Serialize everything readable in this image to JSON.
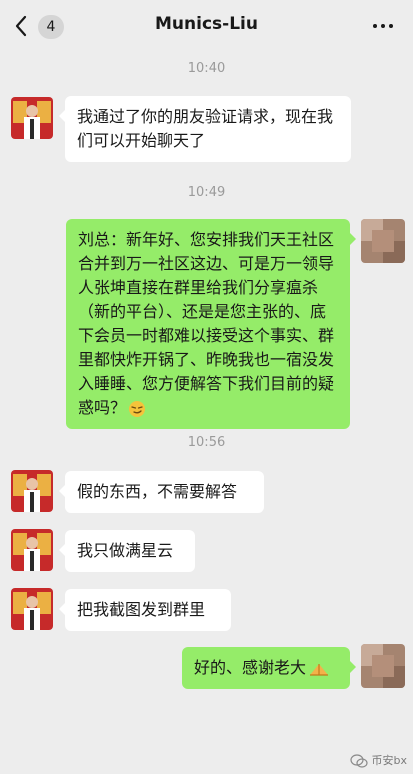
{
  "header": {
    "unread_count": "4",
    "contact_name": "Munics-Liu"
  },
  "messages": [
    {
      "type": "time",
      "text": "10:40"
    },
    {
      "type": "msg",
      "side": "left",
      "text": "我通过了你的朋友验证请求，现在我们可以开始聊天了"
    },
    {
      "type": "time",
      "text": "10:49"
    },
    {
      "type": "msg",
      "side": "right",
      "text": "刘总：新年好、您安排我们天王社区合并到万一社区这边、可是万一领导人张坤直接在群里给我们分享瘟杀（新的平台）、还是是您主张的、底下会员一时都难以接受这个事实、群里都快炸开锅了、昨晚我也一宿没发入睡睡、您方便解答下我们目前的疑惑吗？",
      "emoji": "smirk-emoji"
    },
    {
      "type": "time",
      "text": "10:56"
    },
    {
      "type": "msg",
      "side": "left",
      "text": "假的东西，不需要解答"
    },
    {
      "type": "msg",
      "side": "left",
      "text": "我只做满星云"
    },
    {
      "type": "msg",
      "side": "left",
      "text": "把我截图发到群里"
    },
    {
      "type": "msg",
      "side": "right",
      "text": "好的、感谢老大",
      "emoji": "praying-hands-emoji"
    }
  ],
  "watermark": {
    "text": "币安bx"
  },
  "colors": {
    "background": "#ededed",
    "bubble_self": "#95ec69",
    "bubble_other": "#ffffff",
    "time_text": "#9a9a9a"
  }
}
